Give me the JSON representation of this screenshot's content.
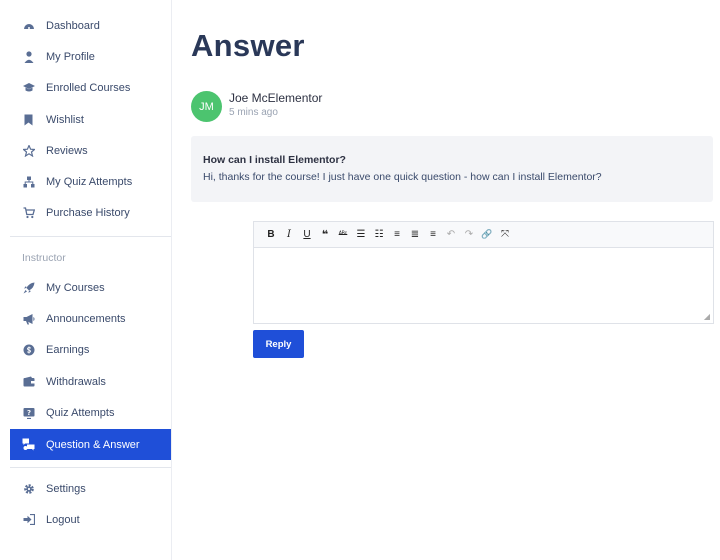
{
  "sidebar": {
    "items": [
      {
        "label": "Dashboard",
        "icon": "dashboard-icon"
      },
      {
        "label": "My Profile",
        "icon": "user-icon"
      },
      {
        "label": "Enrolled Courses",
        "icon": "graduation-cap-icon"
      },
      {
        "label": "Wishlist",
        "icon": "bookmark-icon"
      },
      {
        "label": "Reviews",
        "icon": "star-icon"
      },
      {
        "label": "My Quiz Attempts",
        "icon": "sitemap-icon"
      },
      {
        "label": "Purchase History",
        "icon": "cart-icon"
      }
    ],
    "section_label": "Instructor",
    "instructor_items": [
      {
        "label": "My Courses",
        "icon": "rocket-icon"
      },
      {
        "label": "Announcements",
        "icon": "megaphone-icon"
      },
      {
        "label": "Earnings",
        "icon": "coin-icon"
      },
      {
        "label": "Withdrawals",
        "icon": "wallet-icon"
      },
      {
        "label": "Quiz Attempts",
        "icon": "quiz-icon"
      },
      {
        "label": "Question & Answer",
        "icon": "qa-icon"
      }
    ],
    "bottom_items": [
      {
        "label": "Settings",
        "icon": "gear-icon"
      },
      {
        "label": "Logout",
        "icon": "logout-icon"
      }
    ],
    "active_color": "#1f4fd8"
  },
  "main": {
    "title": "Answer",
    "question": {
      "avatar_initials": "JM",
      "author": "Joe McElementor",
      "time": "5 mins ago",
      "title": "How can I install Elementor?",
      "body": "Hi, thanks for the course! I just have one quick question - how can I install Elementor?"
    },
    "editor": {
      "toolbar": [
        {
          "name": "bold-icon",
          "glyph": "B"
        },
        {
          "name": "italic-icon",
          "glyph": "I"
        },
        {
          "name": "underline-icon",
          "glyph": "U"
        },
        {
          "name": "blockquote-icon",
          "glyph": "❝"
        },
        {
          "name": "strikethrough-icon",
          "glyph": "ᴬᴮᶜ"
        },
        {
          "name": "bullet-list-icon",
          "glyph": "☰"
        },
        {
          "name": "numbered-list-icon",
          "glyph": "☷"
        },
        {
          "name": "align-left-icon",
          "glyph": "≡"
        },
        {
          "name": "align-center-icon",
          "glyph": "≣"
        },
        {
          "name": "align-right-icon",
          "glyph": "≡"
        },
        {
          "name": "undo-icon",
          "glyph": "↶"
        },
        {
          "name": "redo-icon",
          "glyph": "↷"
        },
        {
          "name": "link-icon",
          "glyph": "🔗"
        },
        {
          "name": "fullscreen-icon",
          "glyph": "⤧"
        }
      ]
    },
    "reply_label": "Reply"
  }
}
